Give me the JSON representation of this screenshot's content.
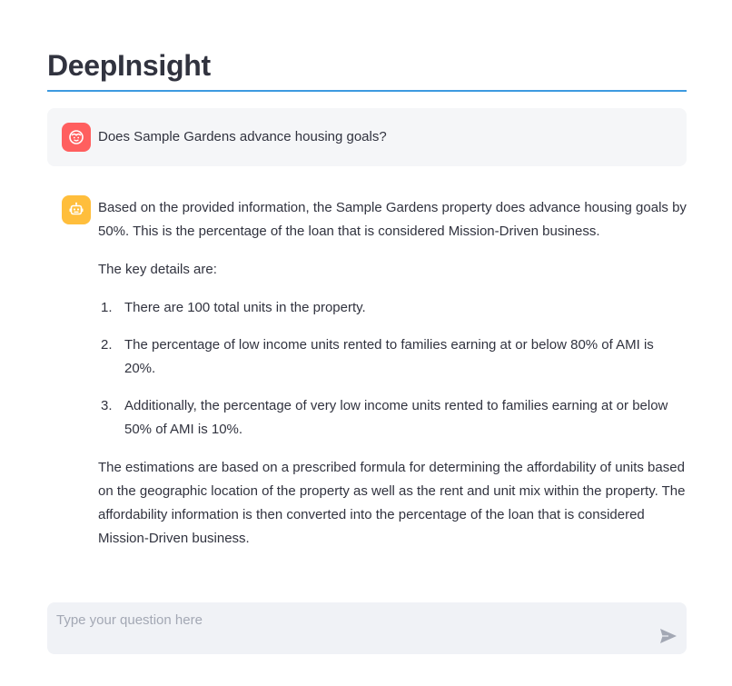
{
  "app": {
    "title": "DeepInsight"
  },
  "colors": {
    "accent_divider": "#3d9ae0",
    "user_avatar": "#ff5f5f",
    "bot_avatar": "#ffbe3c",
    "user_message_bg": "#f5f6f8",
    "input_bg": "#f0f2f6"
  },
  "chat": {
    "user_message": {
      "avatar_icon": "user-face-icon",
      "text": "Does Sample Gardens advance housing goals?"
    },
    "assistant_message": {
      "avatar_icon": "robot-icon",
      "intro": "Based on the provided information, the Sample Gardens property does advance housing goals by 50%. This is the percentage of the loan that is considered Mission-Driven business.",
      "details_heading": "The key details are:",
      "details": [
        {
          "num": "1.",
          "text": "There are 100 total units in the property."
        },
        {
          "num": "2.",
          "text": "The percentage of low income units rented to families earning at or below 80% of AMI is 20%."
        },
        {
          "num": "3.",
          "text": "Additionally, the percentage of very low income units rented to families earning at or below 50% of AMI is 10%."
        }
      ],
      "conclusion": "The estimations are based on a prescribed formula for determining the affordability of units based on the geographic location of the property as well as the rent and unit mix within the property. The affordability information is then converted into the percentage of the loan that is considered Mission-Driven business."
    }
  },
  "input": {
    "placeholder": "Type your question here",
    "value": "",
    "send_icon": "send-icon"
  }
}
